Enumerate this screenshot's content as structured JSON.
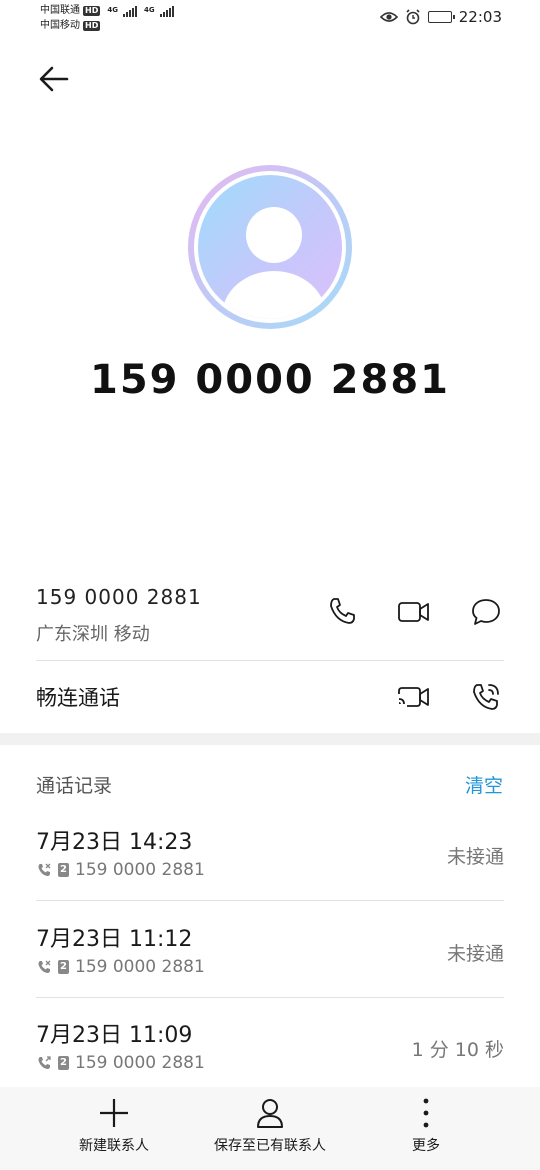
{
  "status_bar": {
    "carrier1": "中国联通",
    "carrier2": "中国移动",
    "hd": "HD",
    "net": "4G",
    "time": "22:03"
  },
  "contact": {
    "big_number": "159 0000 2881",
    "phone_number": "159 0000 2881",
    "location": "广东深圳 移动"
  },
  "changlian": {
    "label": "畅连通话"
  },
  "call_log": {
    "title": "通话记录",
    "clear_label": "清空",
    "entries": [
      {
        "time": "7月23日 14:23",
        "number": "159 0000 2881",
        "sim": "2",
        "status": "未接通"
      },
      {
        "time": "7月23日 11:12",
        "number": "159 0000 2881",
        "sim": "2",
        "status": "未接通"
      },
      {
        "time": "7月23日 11:09",
        "number": "159 0000 2881",
        "sim": "2",
        "status": "1 分 10 秒"
      }
    ]
  },
  "bottom_bar": {
    "new_contact": "新建联系人",
    "save_existing": "保存至已有联系人",
    "more": "更多"
  },
  "colors": {
    "accent": "#2196d8",
    "text": "#1a1a1a",
    "secondary": "#777777"
  },
  "icons": [
    "back-arrow-icon",
    "phone-icon",
    "video-icon",
    "message-icon",
    "video-call-icon",
    "wifi-call-icon",
    "plus-icon",
    "person-icon",
    "more-icon",
    "eye-icon",
    "alarm-icon",
    "battery-icon"
  ]
}
